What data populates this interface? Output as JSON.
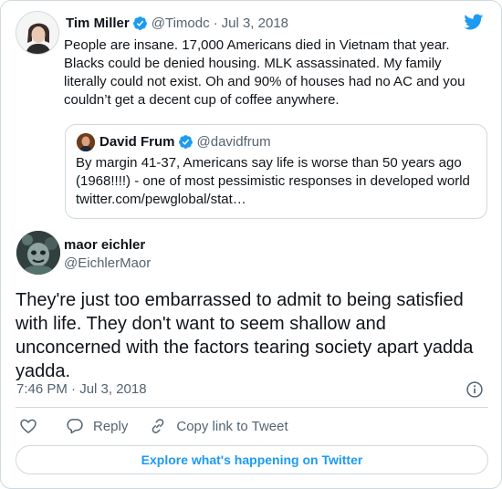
{
  "colors": {
    "accent": "#1d9bf0",
    "text": "#0f1419",
    "muted": "#536471",
    "border": "#cfd9de"
  },
  "quoted_tweet": {
    "name": "Tim Miller",
    "handle": "@Timodc",
    "separator": "·",
    "date": "Jul 3, 2018",
    "text": "People are insane. 17,000 Americans died in Vietnam that year. Blacks could be denied housing. MLK assassinated. My family literally could not exist. Oh and 90% of houses had no AC and you couldn’t get a decent cup of coffee anywhere.",
    "nested_quote": {
      "name": "David Frum",
      "handle": "@davidfrum",
      "text": "By margin 41-37, Americans say life is worse than 50 years ago (1968!!!!) - one of most pessimistic responses in developed world twitter.com/pewglobal/stat…"
    }
  },
  "tweet": {
    "name": "maor eichler",
    "handle": "@EichlerMaor",
    "text": "They're just too embarrassed to admit to being satisfied with life. They don't want to seem shallow and unconcerned with the factors tearing society apart yadda yadda.",
    "timestamp": "7:46 PM · Jul 3, 2018"
  },
  "actions": {
    "reply_label": "Reply",
    "copy_link_label": "Copy link to Tweet"
  },
  "explore_label": "Explore what's happening on Twitter",
  "icons": [
    "verified-badge-icon",
    "twitter-bird-icon",
    "info-icon",
    "heart-icon",
    "reply-icon",
    "link-icon"
  ]
}
